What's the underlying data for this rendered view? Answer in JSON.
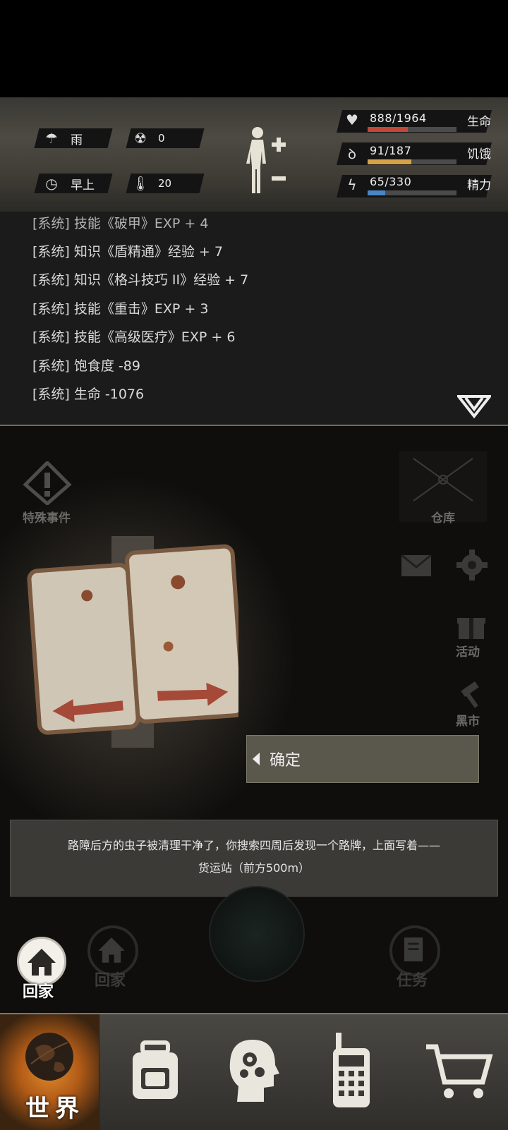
{
  "hud": {
    "weather": "雨",
    "radiation": "0",
    "time_of_day": "早上",
    "temperature": "20",
    "stats": {
      "health": {
        "label": "生命",
        "value": "888/1964",
        "fraction": 0.45,
        "color": "#c0473a"
      },
      "hunger": {
        "label": "饥饿",
        "value": "91/187",
        "fraction": 0.49,
        "color": "#d5a24a"
      },
      "energy": {
        "label": "精力",
        "value": "65/330",
        "fraction": 0.2,
        "color": "#4a86c5"
      }
    }
  },
  "log": {
    "lines": [
      "[系统] 技能《破甲》EXP + 4",
      "[系统] 知识《盾精通》经验 + 7",
      "[系统] 知识《格斗技巧 II》经验 + 7",
      "[系统] 技能《重击》EXP + 3",
      "[系统] 技能《高级医疗》EXP + 6",
      "[系统] 饱食度 -89",
      "[系统] 生命 -1076"
    ]
  },
  "scene": {
    "special_event_label": "特殊事件",
    "storage_label": "仓库",
    "activity_label": "活动",
    "black_market_label": "黑市",
    "confirm_label": "确定",
    "message_line1": "路障后方的虫子被清理干净了，你搜索四周后发现一个路牌，上面写着——",
    "message_line2": "货运站（前方500m）",
    "home_label_active": "回家",
    "home_label_dim": "回家",
    "task_label": "任务"
  },
  "bottom_nav": {
    "world_label": "世界"
  }
}
